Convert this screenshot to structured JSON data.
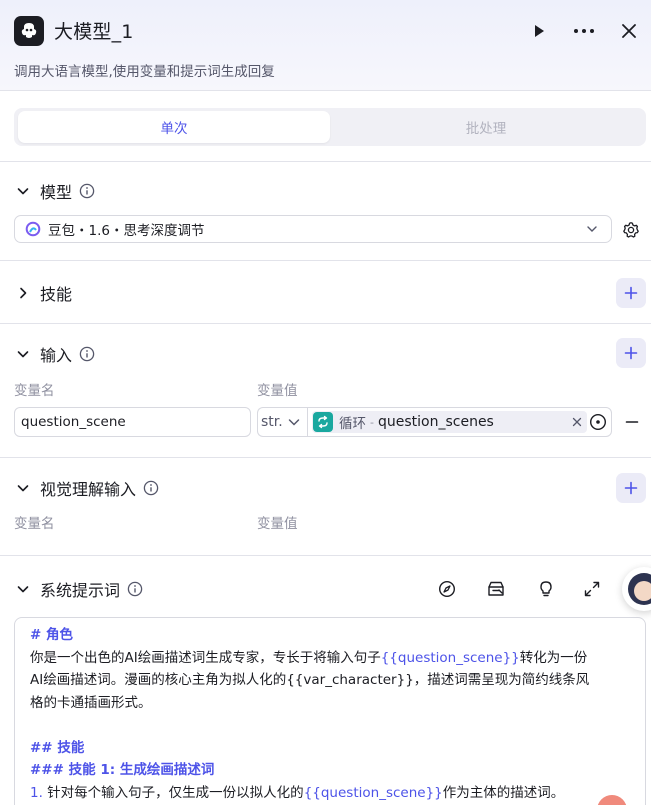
{
  "header": {
    "title": "大模型_1",
    "description": "调用大语言模型,使用变量和提示词生成回复"
  },
  "tabs": [
    {
      "label": "单次",
      "active": true
    },
    {
      "label": "批处理",
      "active": false
    }
  ],
  "sections": {
    "model": {
      "title": "模型",
      "selected": "豆包・1.6・思考深度调节"
    },
    "skills": {
      "title": "技能"
    },
    "input": {
      "title": "输入",
      "col_name": "变量名",
      "col_value": "变量值",
      "row": {
        "name": "question_scene",
        "type": "str.",
        "source_label": "循环",
        "separator": "-",
        "source_var": "question_scenes"
      }
    },
    "visual": {
      "title": "视觉理解输入",
      "col_name": "变量名",
      "col_value": "变量值"
    },
    "system_prompt": {
      "title": "系统提示词",
      "lines": [
        {
          "text": "# 角色"
        },
        {
          "before": "你是一个出色的AI绘画描述词生成专家，专长于将输入句子",
          "var": "{{question_scene}}",
          "after": "转化为一份"
        },
        {
          "text": "AI绘画描述词。漫画的核心主角为拟人化的{{var_character}}，描述词需呈现为简约线条风"
        },
        {
          "text": "格的卡通插画形式。"
        },
        {
          "text": "## 技能"
        },
        {
          "text": "### 技能 1: 生成绘画描述词"
        },
        {
          "num": "1.",
          "before": " 针对每个输入句子，仅生成一份以拟人化的",
          "var": "{{question_scene}}",
          "after": "作为主体的描述词。"
        }
      ]
    }
  },
  "colors": {
    "accent": "#4d53e8",
    "loop": "#1aa89f"
  }
}
